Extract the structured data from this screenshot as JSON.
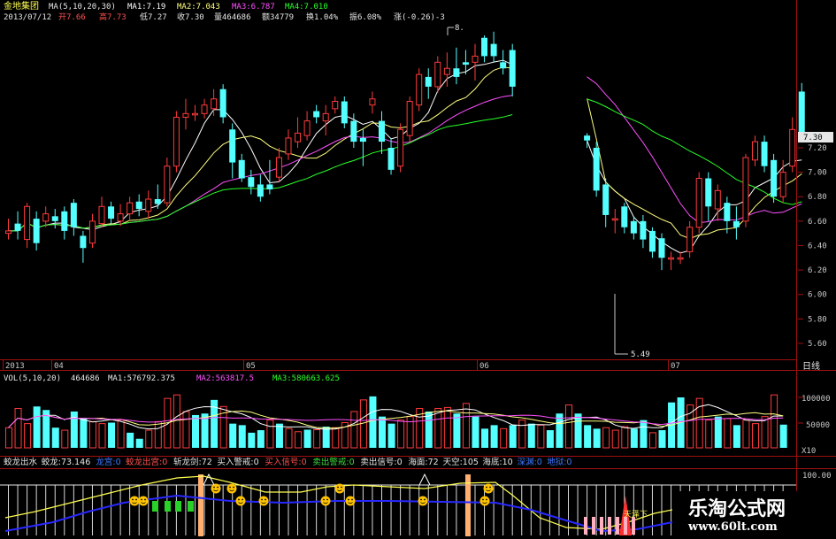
{
  "header": {
    "name": "金地集团",
    "ma_label": "MA(5,10,20,30)",
    "ma1": "MA1:7.19",
    "ma2": "MA2:7.043",
    "ma3": "MA3:6.787",
    "ma4": "MA4:7.010",
    "date": "2013/07/12",
    "open": "开7.66",
    "high": "高7.73",
    "low": "低7.27",
    "close": "收7.30",
    "volume": "量464686",
    "amount": "额34779",
    "turnover": "换1.04%",
    "amplitude": "振6.08%",
    "change": "涨(-0.26)-3"
  },
  "price_labels": {
    "max": "8.",
    "min": "5.49",
    "last": "7.30"
  },
  "date_labels": [
    "2013",
    "04",
    "05",
    "06",
    "07"
  ],
  "period_label": "日线",
  "vol_header": {
    "name": "VOL(5,10,20)",
    "vol": "464686",
    "ma1": "MA1:576792.375",
    "ma2": "MA2:563817.5",
    "ma3": "MA3:580663.625"
  },
  "vol_axis": [
    "100000",
    "50000"
  ],
  "vol_unit": "X10",
  "ind_header": [
    {
      "text": "蛟龙出水",
      "color": "#e6e6e6"
    },
    {
      "text": "蛟龙:73.146",
      "color": "#e6e6e6"
    },
    {
      "text": "龙宫:0",
      "color": "#3c78ff"
    },
    {
      "text": "蛟龙出宫:0",
      "color": "#ff5050"
    },
    {
      "text": "斩龙剑:72",
      "color": "#e6e6e6"
    },
    {
      "text": "买入警戒:0",
      "color": "#e6e6e6"
    },
    {
      "text": "买入信号:0",
      "color": "#ff5050"
    },
    {
      "text": "卖出警戒:0",
      "color": "#3cdc3c"
    },
    {
      "text": "卖出信号:0",
      "color": "#e6e6e6"
    },
    {
      "text": "海面:72",
      "color": "#e6e6e6"
    },
    {
      "text": "天空:105",
      "color": "#e6e6e6"
    },
    {
      "text": "海底:10",
      "color": "#e6e6e6"
    },
    {
      "text": "深渊:0",
      "color": "#3c78ff"
    },
    {
      "text": "地狱:0",
      "color": "#3c78ff"
    }
  ],
  "ind_axis": "100.00",
  "ind_annotation": "天泽下",
  "watermark": {
    "title": "乐淘公式网",
    "url": "www.60lt.com"
  },
  "colors": {
    "up": "#ff3b3b",
    "down": "#54ffff",
    "ma1": "#ffffff",
    "ma2": "#ffff80",
    "ma3": "#ff50ff",
    "ma4": "#28ff28"
  },
  "chart_data": {
    "type": "candlestick",
    "price_axis": [
      7.2,
      7.0,
      6.8,
      6.6,
      6.4,
      6.2,
      6.0,
      5.8,
      5.6
    ],
    "ylim": [
      5.45,
      8.15
    ],
    "candles": [
      [
        6.5,
        6.52,
        6.62,
        6.45
      ],
      [
        6.58,
        6.52,
        6.68,
        6.45
      ],
      [
        6.45,
        6.72,
        6.75,
        6.38
      ],
      [
        6.62,
        6.42,
        6.68,
        6.36
      ],
      [
        6.6,
        6.66,
        6.72,
        6.55
      ],
      [
        6.64,
        6.6,
        6.7,
        6.54
      ],
      [
        6.68,
        6.52,
        6.72,
        6.45
      ],
      [
        6.75,
        6.55,
        6.78,
        6.48
      ],
      [
        6.48,
        6.38,
        6.52,
        6.26
      ],
      [
        6.42,
        6.6,
        6.66,
        6.38
      ],
      [
        6.58,
        6.72,
        6.8,
        6.55
      ],
      [
        6.72,
        6.62,
        6.76,
        6.58
      ],
      [
        6.6,
        6.66,
        6.74,
        6.56
      ],
      [
        6.66,
        6.75,
        6.8,
        6.6
      ],
      [
        6.76,
        6.7,
        6.82,
        6.64
      ],
      [
        6.68,
        6.78,
        6.85,
        6.62
      ],
      [
        6.78,
        6.74,
        6.9,
        6.7
      ],
      [
        6.75,
        7.05,
        7.12,
        6.72
      ],
      [
        7.05,
        7.45,
        7.5,
        7.0
      ],
      [
        7.45,
        7.48,
        7.6,
        7.35
      ],
      [
        7.48,
        7.48,
        7.55,
        7.42
      ],
      [
        7.48,
        7.55,
        7.6,
        7.44
      ],
      [
        7.52,
        7.6,
        7.68,
        7.46
      ],
      [
        7.68,
        7.45,
        7.72,
        7.4
      ],
      [
        7.35,
        7.08,
        7.4,
        6.95
      ],
      [
        7.1,
        6.95,
        7.15,
        6.92
      ],
      [
        6.96,
        6.88,
        7.02,
        6.82
      ],
      [
        6.9,
        6.8,
        6.98,
        6.76
      ],
      [
        6.9,
        6.86,
        7.1,
        6.82
      ],
      [
        6.96,
        7.12,
        7.2,
        6.92
      ],
      [
        7.15,
        7.28,
        7.35,
        7.1
      ],
      [
        7.25,
        7.32,
        7.45,
        7.2
      ],
      [
        7.3,
        7.42,
        7.5,
        7.26
      ],
      [
        7.5,
        7.45,
        7.55,
        7.4
      ],
      [
        7.42,
        7.48,
        7.55,
        7.3
      ],
      [
        7.52,
        7.58,
        7.62,
        7.48
      ],
      [
        7.58,
        7.4,
        7.62,
        7.36
      ],
      [
        7.42,
        7.25,
        7.48,
        7.2
      ],
      [
        7.28,
        7.25,
        7.35,
        7.05
      ],
      [
        7.55,
        7.6,
        7.66,
        7.48
      ],
      [
        7.42,
        7.25,
        7.5,
        7.15
      ],
      [
        7.2,
        7.02,
        7.28,
        6.98
      ],
      [
        7.05,
        7.35,
        7.4,
        7.0
      ],
      [
        7.3,
        7.58,
        7.62,
        7.25
      ],
      [
        7.55,
        7.8,
        7.85,
        7.5
      ],
      [
        7.78,
        7.7,
        7.85,
        7.6
      ],
      [
        7.7,
        7.9,
        7.95,
        7.65
      ],
      [
        7.8,
        7.85,
        7.98,
        7.7
      ],
      [
        7.85,
        7.78,
        8.02,
        7.72
      ],
      [
        7.9,
        7.88,
        8.0,
        7.8
      ],
      [
        7.9,
        7.95,
        8.05,
        7.75
      ],
      [
        8.1,
        7.95,
        8.12,
        7.9
      ],
      [
        8.05,
        7.95,
        8.15,
        7.9
      ],
      [
        7.9,
        7.85,
        8.0,
        7.8
      ],
      [
        8.0,
        7.7,
        8.05,
        7.62
      ],
      null,
      null,
      null,
      null,
      null,
      null,
      null,
      [
        7.3,
        7.26,
        7.32,
        7.2
      ],
      [
        7.2,
        6.85,
        7.25,
        6.8
      ],
      [
        6.9,
        6.65,
        6.95,
        6.55
      ],
      [
        6.62,
        6.62,
        6.7,
        6.5
      ],
      [
        6.72,
        6.55,
        6.75,
        6.5
      ],
      [
        6.6,
        6.5,
        6.64,
        6.45
      ],
      [
        6.6,
        6.45,
        6.65,
        6.38
      ],
      [
        6.52,
        6.35,
        6.55,
        6.3
      ],
      [
        6.46,
        6.3,
        6.5,
        6.2
      ],
      [
        6.3,
        6.3,
        6.35,
        6.2
      ],
      [
        6.3,
        6.3,
        6.35,
        6.25
      ],
      [
        6.35,
        6.55,
        6.6,
        6.3
      ],
      [
        6.55,
        6.95,
        7.0,
        6.5
      ],
      [
        6.95,
        6.72,
        7.0,
        6.6
      ],
      [
        6.7,
        6.85,
        6.9,
        6.6
      ],
      [
        6.75,
        6.6,
        6.8,
        6.5
      ],
      [
        6.6,
        6.55,
        6.72,
        6.45
      ],
      [
        6.6,
        7.12,
        7.15,
        6.55
      ],
      [
        7.1,
        7.25,
        7.3,
        7.05
      ],
      [
        7.25,
        7.05,
        7.3,
        7.0
      ],
      [
        7.1,
        6.8,
        7.15,
        6.75
      ],
      [
        6.8,
        7.0,
        7.1,
        6.75
      ],
      [
        7.05,
        7.35,
        7.45,
        7.0
      ],
      [
        7.66,
        7.3,
        7.73,
        7.27
      ]
    ],
    "volume": [
      [
        40000,
        1
      ],
      [
        78000,
        1
      ],
      [
        48000,
        1
      ],
      [
        82000,
        0
      ],
      [
        75000,
        0
      ],
      [
        40000,
        0
      ],
      [
        35000,
        1
      ],
      [
        72000,
        0
      ],
      [
        58000,
        0
      ],
      [
        52000,
        1
      ],
      [
        48000,
        1
      ],
      [
        50000,
        0
      ],
      [
        55000,
        1
      ],
      [
        30000,
        0
      ],
      [
        18000,
        0
      ],
      [
        35000,
        1
      ],
      [
        52000,
        1
      ],
      [
        98000,
        1
      ],
      [
        105000,
        1
      ],
      [
        72000,
        1
      ],
      [
        65000,
        0
      ],
      [
        68000,
        0
      ],
      [
        95000,
        0
      ],
      [
        82000,
        1
      ],
      [
        48000,
        0
      ],
      [
        45000,
        0
      ],
      [
        30000,
        0
      ],
      [
        35000,
        0
      ],
      [
        55000,
        1
      ],
      [
        48000,
        0
      ],
      [
        38000,
        1
      ],
      [
        32000,
        1
      ],
      [
        36000,
        0
      ],
      [
        36000,
        1
      ],
      [
        42000,
        0
      ],
      [
        40000,
        1
      ],
      [
        50000,
        1
      ],
      [
        72000,
        1
      ],
      [
        95000,
        1
      ],
      [
        102000,
        0
      ],
      [
        62000,
        0
      ],
      [
        48000,
        0
      ],
      [
        55000,
        1
      ],
      [
        62000,
        1
      ],
      [
        78000,
        1
      ],
      [
        72000,
        0
      ],
      [
        78000,
        1
      ],
      [
        80000,
        1
      ],
      [
        68000,
        0
      ],
      [
        88000,
        1
      ],
      [
        62000,
        0
      ],
      [
        38000,
        0
      ],
      [
        45000,
        0
      ],
      [
        38000,
        1
      ],
      [
        45000,
        0
      ],
      [
        55000,
        1
      ],
      [
        48000,
        0
      ],
      [
        45000,
        1
      ],
      [
        35000,
        0
      ],
      [
        68000,
        0
      ],
      [
        85000,
        1
      ],
      [
        68000,
        0
      ],
      [
        45000,
        0
      ],
      [
        38000,
        0
      ],
      [
        40000,
        1
      ],
      [
        35000,
        1
      ],
      [
        42000,
        1
      ],
      [
        38000,
        0
      ],
      [
        55000,
        0
      ],
      [
        30000,
        1
      ],
      [
        35000,
        0
      ],
      [
        90000,
        0
      ],
      [
        100000,
        0
      ],
      [
        85000,
        1
      ],
      [
        98000,
        1
      ],
      [
        55000,
        1
      ],
      [
        62000,
        0
      ],
      [
        58000,
        1
      ],
      [
        45000,
        0
      ],
      [
        55000,
        1
      ],
      [
        48000,
        1
      ],
      [
        62000,
        1
      ],
      [
        105000,
        1
      ],
      [
        46000,
        0
      ]
    ]
  }
}
